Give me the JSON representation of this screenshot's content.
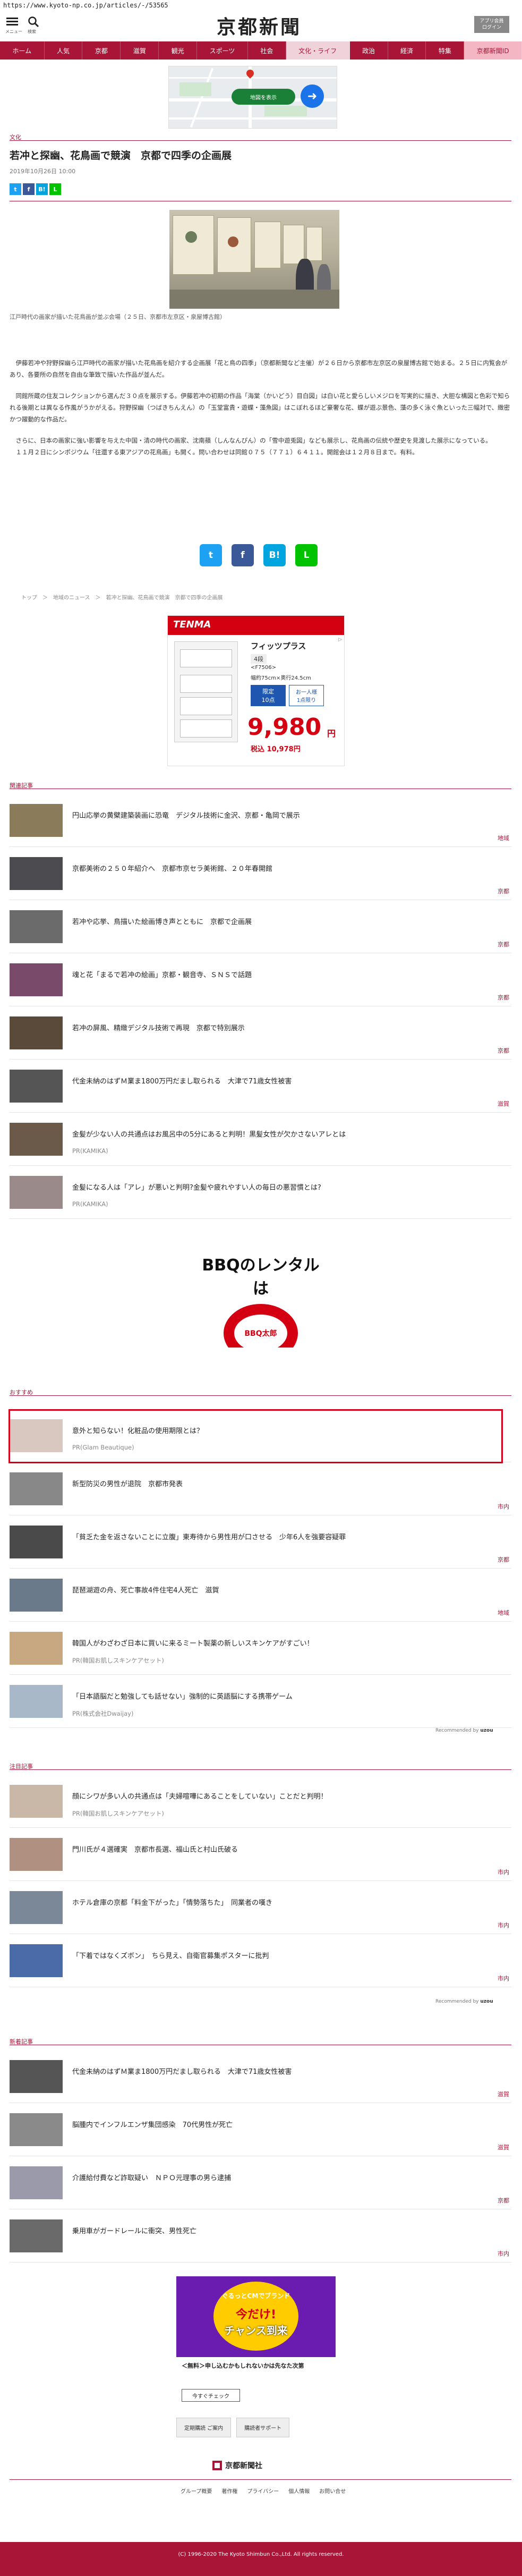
{
  "browser": {
    "url": "https://www.kyoto-np.co.jp/articles/-/53565"
  },
  "header": {
    "menu_label": "メニュー",
    "search_label": "検索",
    "logo": "京都新聞",
    "member_button": "アプリ会員\nログイン"
  },
  "nav": {
    "items": [
      "ホーム",
      "人気",
      "京都",
      "滋賀",
      "観光",
      "スポーツ",
      "社会",
      "文化・ライフ",
      "政治",
      "経済",
      "特集",
      "京都新聞ID"
    ],
    "active_index": 7,
    "colors": {
      "bar": "#a81537",
      "active_bg": "#f0d3da",
      "special_bg": "#f5b6c4"
    }
  },
  "map": {
    "button_label": "地図を表示",
    "direction_icon": "directions-icon"
  },
  "article": {
    "section": "文化",
    "headline": "若冲と探幽、花鳥画で競演　京都で四季の企画展",
    "date": "2019年10月26日 10:00",
    "share_buttons": [
      {
        "name": "twitter",
        "glyph": "t",
        "color": "#1da1f2"
      },
      {
        "name": "facebook",
        "glyph": "f",
        "color": "#3b5998"
      },
      {
        "name": "hatena",
        "glyph": "B!",
        "color": "#00a4de"
      },
      {
        "name": "line",
        "glyph": "L",
        "color": "#00c300"
      }
    ],
    "caption": "江戸時代の画家が描いた花鳥画が並ぶ会場（２５日、京都市左京区・泉屋博古館）",
    "paragraphs": [
      "　伊藤若冲や狩野探幽ら江戸時代の画家が描いた花鳥画を紹介する企画展「花と鳥の四季」（京都新聞など主催）が２６日から京都市左京区の泉屋博古館で始まる。２５日に内覧会があり、各要所の自然を自由な筆致で描いた作品が並んだ。",
      "　同館所蔵の住友コレクションから選んだ３０点を展示する。伊藤若冲の初期の作品「海棠（かいどう）目白図」は白い花と愛らしいメジロを写実的に描き、大胆な構図と色彩で知られる後期とは異なる作風がうかがえる。狩野探幽（つばきちんえん）の「玉堂富貴・遊蝶・藻魚図」はこぼれるほど豪奢な花、蝶が遊ぶ景色、藻の多く泳ぐ魚といった三幅対で、緻密かつ躍動的な作品だ。",
      "　さらに、日本の画家に強い影響を与えた中国・清の時代の画家、沈南蘋（しんなんぴん）の「雪中遊兎図」なども展示し、花鳥画の伝統や歴史を見渡した展示になっている。",
      "　１１月２日にシンポジウム「往還する東アジアの花鳥画」も開く。問い合わせは同館０７５（７７１）６４１１。開館会は１２月８日まで。有料。"
    ],
    "big_share": [
      {
        "glyph": "t",
        "color": "#1da1f2"
      },
      {
        "glyph": "f",
        "color": "#3b5998"
      },
      {
        "glyph": "B!",
        "color": "#00a4de"
      },
      {
        "glyph": "L",
        "color": "#00c300"
      }
    ],
    "breadcrumb": "トップ　＞　地域のニュース　＞　若冲と探幽、花鳥画で競演　京都で四季の企画展"
  },
  "ad_tenma": {
    "brand": "TENMA",
    "product": "フィッツプラス",
    "model": "4段",
    "code": "<F7506>",
    "size": "幅約75cm×奥行24.5cm",
    "badge1": "限定\n10点",
    "badge2": "お一人様\n1点限り",
    "price": "9,980",
    "price_unit": "円",
    "price_tax": "税込 10,978円"
  },
  "related": {
    "title": "関連記事",
    "items": [
      {
        "title": "円山応挙の黄檗建築装画に恐竜　デジタル技術に金沢、京都・亀岡で展示",
        "cat": "地域",
        "thumb": "#8a7b5a"
      },
      {
        "title": "京都美術の２５０年紹介へ　京都市京セラ美術館、２０年春開館",
        "cat": "京都",
        "thumb": "#4b4b50"
      },
      {
        "title": "若冲や応挙、鳥描いた絵画博き声とともに　京都で企画展",
        "cat": "京都",
        "thumb": "#6b6b6b"
      },
      {
        "title": "魂と花「まるで若冲の絵画」京都・観音寺、ＳＮＳで話題",
        "cat": "京都",
        "thumb": "#7a4a6a"
      },
      {
        "title": "若冲の屏風、精緻デジタル技術で再現　京都で特別展示",
        "cat": "京都",
        "thumb": "#5a4a3a"
      },
      {
        "title": "代金未納のはずＭ業ま1800万円だまし取られる　大津で71歳女性被害",
        "cat": "滋賀",
        "thumb": "#555555"
      },
      {
        "title": "金髪が少ない人の共通点はお風呂中の5分にあると判明！黒髪女性が欠かさないアレとは",
        "pr": "PR(KAMIKA)",
        "thumb": "#6b5a4a"
      },
      {
        "title": "金髪になる人は「アレ」が悪いと判明?金髪や疲れやすい人の毎日の悪習慣とは?",
        "pr": "PR(KAMIKA)",
        "thumb": "#9a8a8a"
      }
    ]
  },
  "bbq_ad": {
    "line1": "BBQのレンタルは",
    "brand": "BBQ太郎"
  },
  "recommend": {
    "title": "おすすめ",
    "items": [
      {
        "title": "意外と知らない！化粧品の使用期限とは？",
        "pr": "PR(Glam Beautique)",
        "thumb": "#d9c8c0"
      },
      {
        "title": "新型防災の男性が退院　京都市発表",
        "cat": "市内",
        "thumb": "#888888"
      },
      {
        "title": "「貧乏た金を返さないことに立腹」東寿待から男性用が口させる　少年6人を強要容疑罪",
        "cat": "京都",
        "thumb": "#4a4a4a"
      },
      {
        "title": "琵琶湖遊の舟、死亡事故4件住宅4人死亡　滋賀",
        "cat": "地域",
        "thumb": "#6a7a8a"
      },
      {
        "title": "韓国人がわざわざ日本に買いに来るミート製薬の新しいスキンケアがすごい！",
        "pr": "PR(韓国お肌しスキンケアセット)",
        "thumb": "#c8a880"
      },
      {
        "title": "「日本語脳だと勉強しても話せない」強制的に英語脳にする携帯ゲーム",
        "pr": "PR(株式会社Dwaijay)",
        "thumb": "#a8b8c8"
      }
    ],
    "by": "Recommended by",
    "by_brand": "uzou"
  },
  "featured": {
    "title": "注目記事",
    "items": [
      {
        "title": "顔にシワが多い人の共通点は「夫婦喧嘩にあることをしていない」ことだと判明！",
        "pr": "PR(韓国お肌しスキンケアセット)",
        "thumb": "#c9b8a8"
      },
      {
        "title": "門川氏が４選確実　京都市長選、福山氏と村山氏破る",
        "cat": "市内",
        "thumb": "#b09080"
      },
      {
        "title": "ホテル倉庫の京都「料金下がった」「情勢落ちた」　同業者の嘆き",
        "cat": "市内",
        "thumb": "#7a8898"
      },
      {
        "title": "「下着ではなくズボン」　ちら見え、自衛官募集ポスターに批判",
        "cat": "市内",
        "thumb": "#4a6aa8"
      }
    ],
    "by": "Recommended by",
    "by_brand": "uzou"
  },
  "latest": {
    "title": "新着記事",
    "items": [
      {
        "title": "代金未納のはずＭ業ま1800万円だまし取られる　大津で71歳女性被害",
        "cat": "滋賀",
        "thumb": "#555555"
      },
      {
        "title": "脳腫内でインフルエンザ集団感染　70代男性が死亡",
        "cat": "滋賀",
        "thumb": "#8a8a8a"
      },
      {
        "title": "介護給付費など詐取疑い　ＮＰＯ元理事の男ら逮捕",
        "cat": "京都",
        "thumb": "#9a9aaa"
      },
      {
        "title": "乗用車がガードレールに衝突、男性死亡",
        "cat": "市内",
        "thumb": "#6a6a6a"
      }
    ]
  },
  "bottom_ad": {
    "line1": "ぐるっとCMでブランド",
    "line2": "今だけ!",
    "line3": "チャンス到来",
    "sub": "＜無料＞申し込むかもしれないかは先なた次第",
    "button": "今すぐチェック"
  },
  "footer": {
    "buttons": [
      "定期購読 ご案内",
      "購読者サポート"
    ],
    "logo": "京都新聞社",
    "links": [
      "グループ概要",
      "著作権",
      "プライバシー",
      "個人情報",
      "お問い合せ"
    ],
    "copyright": "(C) 1996-2020 The Kyoto Shimbun Co.,Ltd. All rights reserved."
  }
}
